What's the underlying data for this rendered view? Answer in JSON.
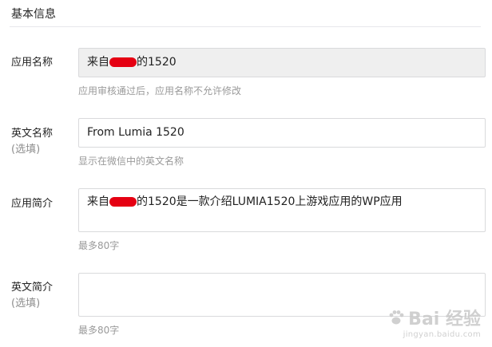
{
  "section": {
    "title": "基本信息"
  },
  "fields": [
    {
      "label": "应用名称",
      "optional": "",
      "value_prefix": "来自",
      "value_suffix": "的1520",
      "hint": "应用审核通过后，应用名称不允许修改"
    },
    {
      "label": "英文名称",
      "optional": "(选填)",
      "value": "From Lumia 1520",
      "hint": "显示在微信中的英文名称"
    },
    {
      "label": "应用简介",
      "optional": "",
      "value_prefix": "来自",
      "value_suffix": "的1520是一款介绍LUMIA1520上游戏应用的WP应用",
      "hint": "最多80字"
    },
    {
      "label": "英文简介",
      "optional": "(选填)",
      "value": "",
      "hint": "最多80字"
    }
  ],
  "watermark": {
    "brand": "Bai 经验",
    "url": "jingyan.baidu.com"
  },
  "colors": {
    "redaction": "#e50012",
    "hint": "#9a9a9a",
    "readonly_bg": "#efefef"
  }
}
